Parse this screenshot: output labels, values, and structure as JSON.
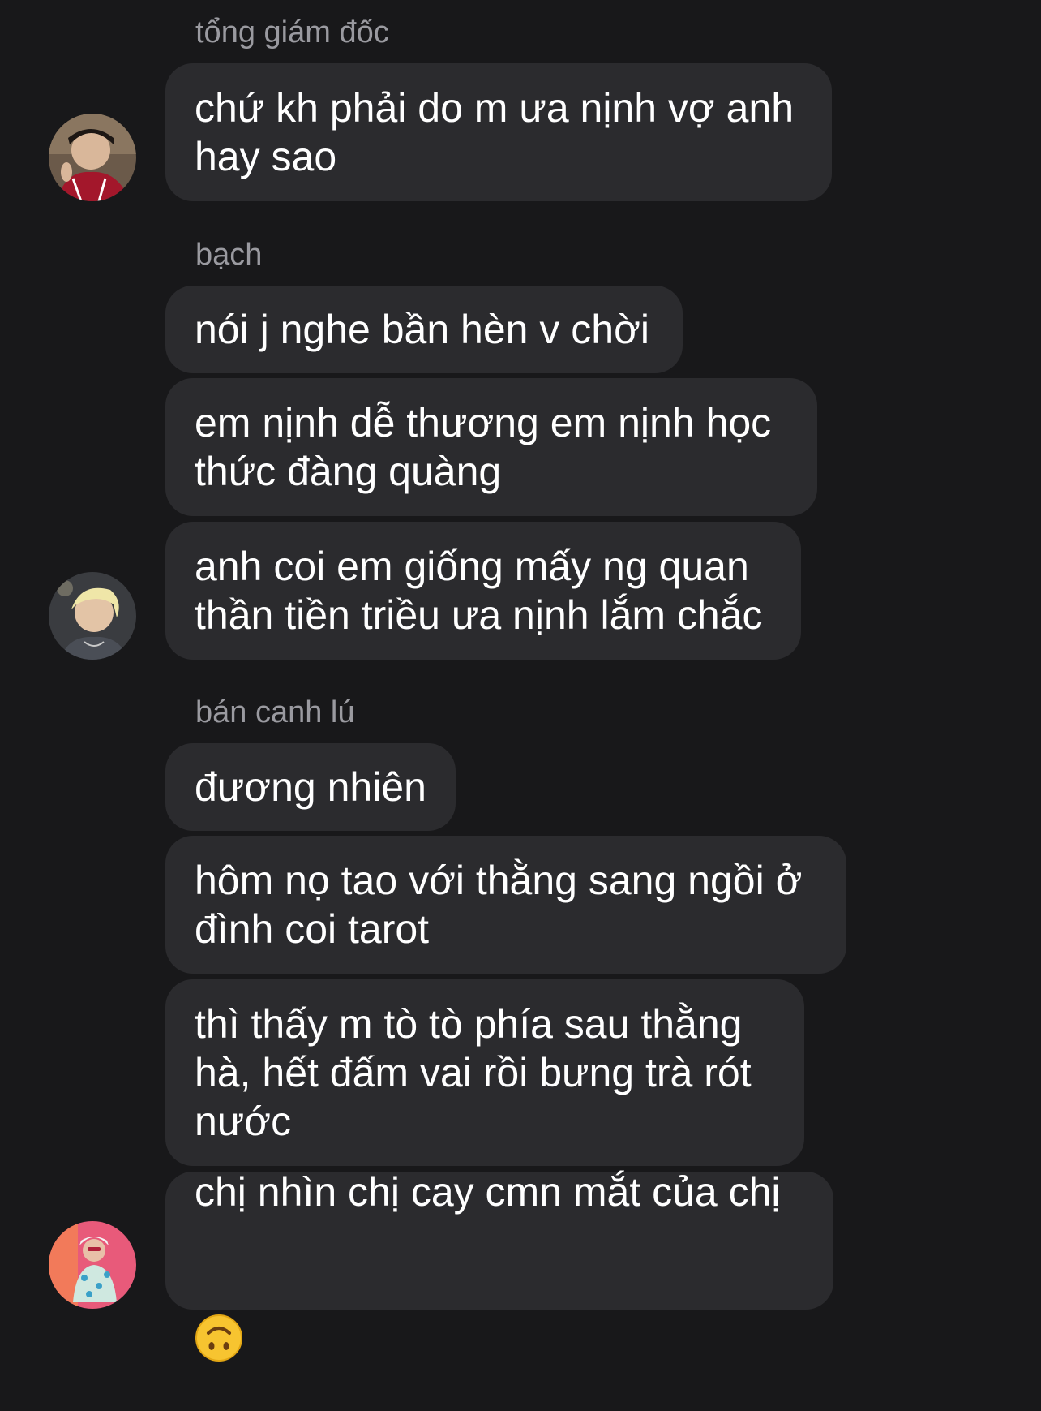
{
  "conversation": {
    "groups": [
      {
        "sender": "tổng giám đốc",
        "messages": [
          "chứ kh phải do m ưa nịnh vợ anh\nhay sao"
        ]
      },
      {
        "sender": "bạch",
        "messages": [
          "nói j nghe bần hèn v chời",
          "em nịnh dễ thương em nịnh học\nthức đàng quàng",
          "anh coi em giống mấy ng quan\nthần tiền triều ưa nịnh lắm chắc"
        ]
      },
      {
        "sender": "bán canh lú",
        "messages": [
          "đương nhiên",
          "hôm nọ tao với thằng sang ngồi ở\nđình coi tarot",
          "thì thấy m tò tò phía sau thằng\nhà, hết đấm vai rồi bưng trà rót\nnước",
          "chị nhìn chị cay cmn mắt của chị"
        ]
      }
    ]
  },
  "emoji": {
    "name": "upside-down-face-emoji"
  },
  "colors": {
    "background": "#18181a",
    "bubble": "#2b2b2e",
    "sender_text": "#9a9aa0",
    "message_text": "#ffffff"
  }
}
